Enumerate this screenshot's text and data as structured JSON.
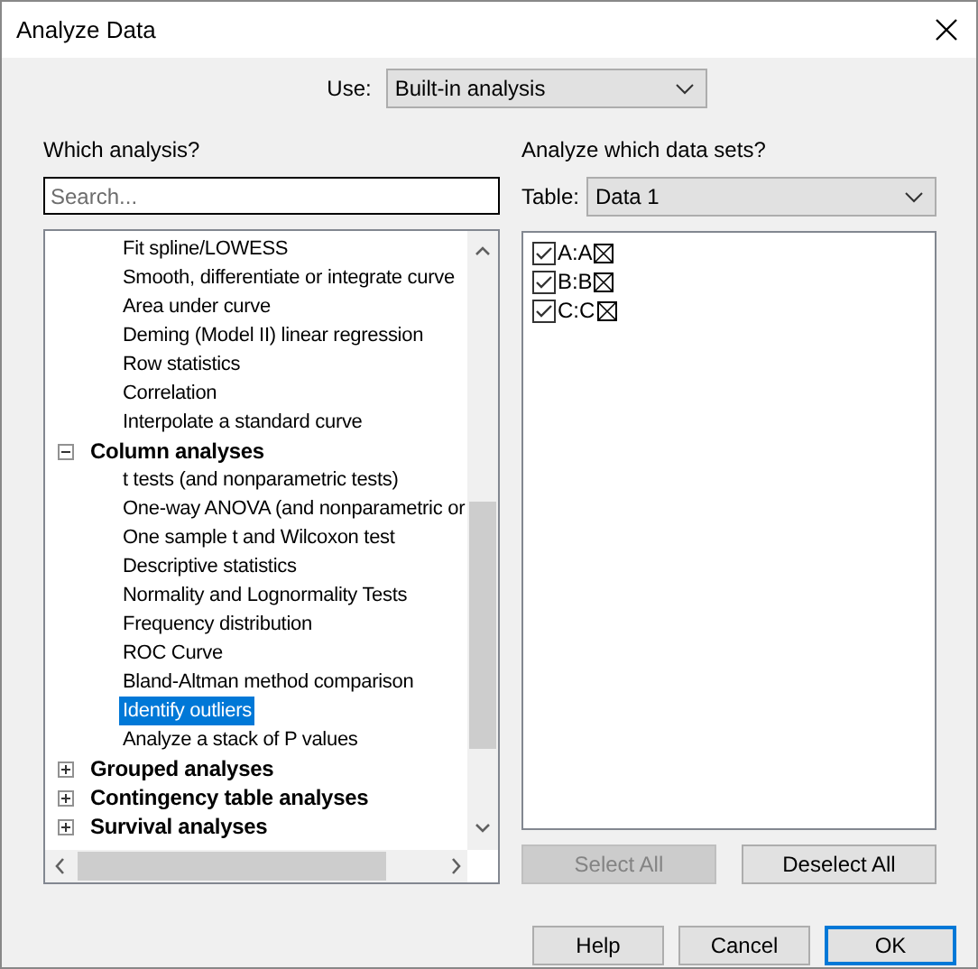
{
  "window": {
    "title": "Analyze Data"
  },
  "use": {
    "label": "Use:",
    "value": "Built-in analysis"
  },
  "analysis": {
    "heading": "Which analysis?",
    "search": {
      "placeholder": "Search..."
    },
    "tree": [
      {
        "children": [
          {
            "label": "Fit spline/LOWESS",
            "selected": false
          },
          {
            "label": "Smooth, differentiate or integrate curve",
            "selected": false
          },
          {
            "label": "Area under curve",
            "selected": false
          },
          {
            "label": "Deming (Model II) linear regression",
            "selected": false
          },
          {
            "label": "Row statistics",
            "selected": false
          },
          {
            "label": "Correlation",
            "selected": false
          },
          {
            "label": "Interpolate a standard curve",
            "selected": false
          }
        ]
      },
      {
        "label": "Column analyses",
        "expanded": true,
        "children": [
          {
            "label": "t tests (and nonparametric tests)",
            "selected": false
          },
          {
            "label": "One-way ANOVA (and nonparametric or",
            "selected": false
          },
          {
            "label": "One sample t and Wilcoxon test",
            "selected": false
          },
          {
            "label": "Descriptive statistics",
            "selected": false
          },
          {
            "label": "Normality and Lognormality Tests",
            "selected": false
          },
          {
            "label": "Frequency distribution",
            "selected": false
          },
          {
            "label": "ROC Curve",
            "selected": false
          },
          {
            "label": "Bland-Altman method comparison",
            "selected": false
          },
          {
            "label": "Identify outliers",
            "selected": true
          },
          {
            "label": "Analyze a stack of P values",
            "selected": false
          }
        ]
      },
      {
        "label": "Grouped analyses",
        "expanded": false
      },
      {
        "label": "Contingency table analyses",
        "expanded": false
      },
      {
        "label": "Survival analyses",
        "expanded": false
      }
    ]
  },
  "datasets": {
    "heading": "Analyze which data sets?",
    "table_label": "Table:",
    "table_value": "Data 1",
    "items": [
      {
        "label": "A:A",
        "checked": true
      },
      {
        "label": "B:B",
        "checked": true
      },
      {
        "label": "C:C",
        "checked": true
      }
    ],
    "buttons": [
      {
        "label": "Select All",
        "disabled": true
      },
      {
        "label": "Deselect All",
        "disabled": false
      }
    ]
  },
  "footer": [
    {
      "label": "Help",
      "default": false
    },
    {
      "label": "Cancel",
      "default": false
    },
    {
      "label": "OK",
      "default": true
    }
  ]
}
